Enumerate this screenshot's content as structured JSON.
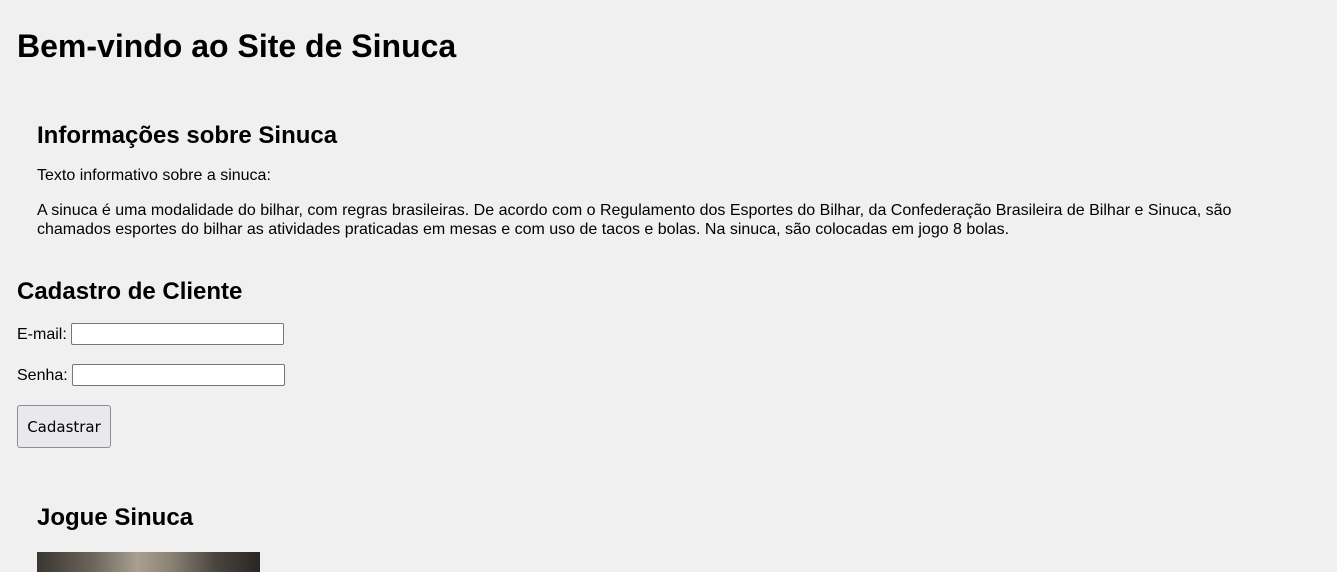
{
  "page": {
    "title": "Bem-vindo ao Site de Sinuca"
  },
  "info": {
    "heading": "Informações sobre Sinuca",
    "intro": "Texto informativo sobre a sinuca:",
    "body": "A sinuca é uma modalidade do bilhar, com regras brasileiras. De acordo com o Regulamento dos Esportes do Bilhar, da Confederação Brasileira de Bilhar e Sinuca, são chamados esportes do bilhar as atividades praticadas em mesas e com uso de tacos e bolas. Na sinuca, são colocadas em jogo 8 bolas."
  },
  "register": {
    "heading": "Cadastro de Cliente",
    "email_label": "E-mail:",
    "email_value": "",
    "senha_label": "Senha:",
    "senha_value": "",
    "submit_label": "Cadastrar"
  },
  "game": {
    "heading": "Jogue Sinuca"
  }
}
